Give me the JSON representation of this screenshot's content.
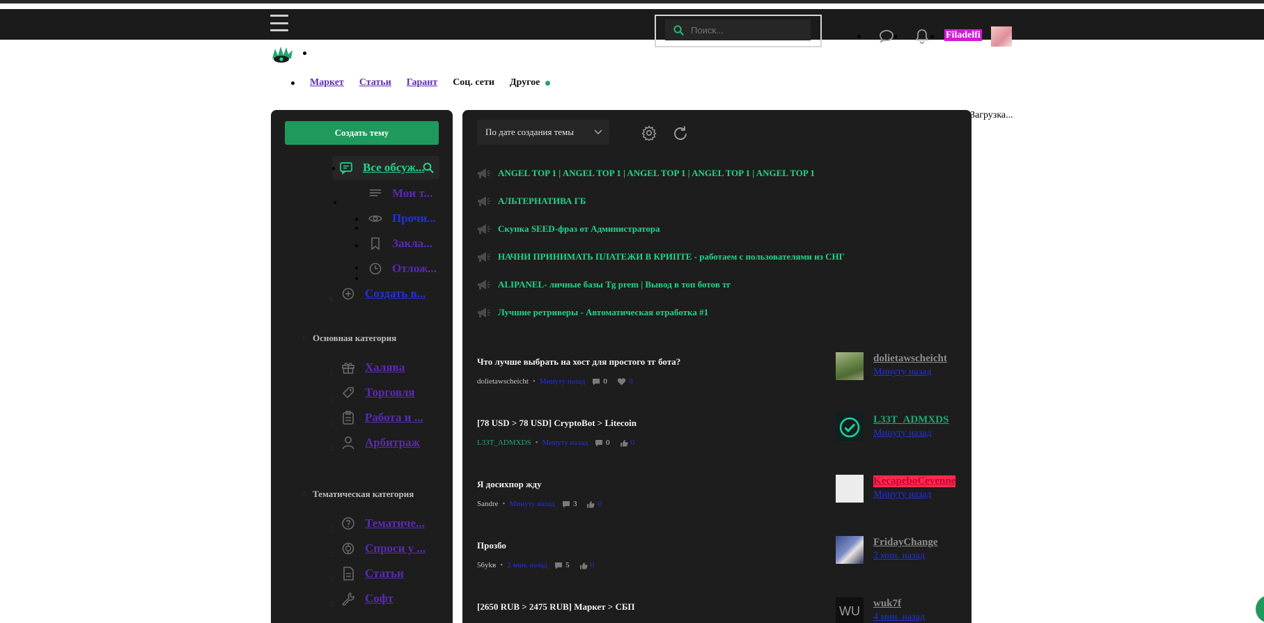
{
  "header": {
    "search_placeholder": "Поиск...",
    "username": "Filadelfi",
    "icons": [
      "menu-icon",
      "search-icon",
      "chat-icon",
      "bell-icon"
    ]
  },
  "nav": {
    "items": [
      {
        "label": "Маркет"
      },
      {
        "label": "Статьи"
      },
      {
        "label": "Гарант"
      },
      {
        "label": "Соц. сети"
      },
      {
        "label": "Другое"
      }
    ]
  },
  "loading_text": "Загрузка...",
  "sidebar": {
    "create_label": "Создать тему",
    "all_label": "Все обсуж...",
    "sub_items": [
      {
        "label": "Мои т..."
      },
      {
        "label": "Прочи..."
      },
      {
        "label": "Закла..."
      },
      {
        "label": "Отлож..."
      }
    ],
    "create_link": "Создать в...",
    "section1": {
      "number": "1.",
      "title": "Основная категория",
      "items": [
        {
          "num": "1.",
          "label": "Халява",
          "icon": "gift-icon"
        },
        {
          "num": "2.",
          "label": "Торговля",
          "icon": "trade-icon"
        },
        {
          "num": "3.",
          "label": "Работа и ...",
          "icon": "clipboard-icon"
        },
        {
          "num": "4.",
          "label": "Арбитраж",
          "icon": "user-icon"
        }
      ]
    },
    "section2": {
      "number": "2.",
      "title": "Тематическая категория",
      "items": [
        {
          "num": "1.",
          "label": "Тематиче...",
          "icon": "question-icon"
        },
        {
          "num": "2.",
          "label": "Спроси у ...",
          "icon": "ai-icon"
        },
        {
          "num": "3.",
          "label": "Статьи",
          "icon": "document-icon"
        },
        {
          "num": "4.",
          "label": "Софт",
          "icon": "wrench-icon"
        }
      ]
    }
  },
  "main": {
    "sort_label": "По дате создания темы",
    "announcements": [
      "ANGEL TOP 1 | ANGEL TOP 1 | ANGEL TOP 1 | ANGEL TOP 1 | ANGEL TOP 1",
      "АЛЬТЕРНАТИВА ГБ",
      "Скупка SEED-фраз от Администратора",
      "НАЧНИ ПРИНИМАТЬ ПЛАТЕЖИ В КРИПТЕ - работаем с пользователями из СНГ",
      "ALIPANEL- личные базы Tg prem | Вывод в топ ботов тг",
      "Лучшие ретриверы - Автоматическая отработка #1"
    ],
    "threads": [
      {
        "title": "Что лучше выбрать на хост для простого тг бота?",
        "author": "dolietawscheicht",
        "time": "Минуту назад",
        "replies": "0",
        "likes": "0",
        "last_user": "dolietawscheicht",
        "last_time": "Минуту назад"
      },
      {
        "title": "[78 USD > 78 USD] CryptoBot > Litecoin",
        "author": "L33T_ADMXDS",
        "time": "Минуту назад",
        "replies": "0",
        "likes": "0",
        "last_user": "L33T_ADMXDS",
        "last_time": "Минуту назад"
      },
      {
        "title": "Я досихпор жду",
        "author": "Sandre",
        "time": "Минуту назад",
        "replies": "3",
        "likes": "0",
        "last_user": "KecapeboCevenne",
        "last_time": "Минуту назад"
      },
      {
        "title": "Прозбо",
        "author": "56ykв",
        "time": "2 мин. назад",
        "replies": "5",
        "likes": "0",
        "last_user": "FridayChange",
        "last_time": "2 мин. назад"
      },
      {
        "title": "[2650 RUB > 2475 RUB] Маркет > СБП",
        "author": "",
        "time": "",
        "replies": "",
        "likes": "",
        "last_user": "wuk7f",
        "last_time": "4 мин. назад",
        "avatar_text": "WU"
      }
    ]
  }
}
